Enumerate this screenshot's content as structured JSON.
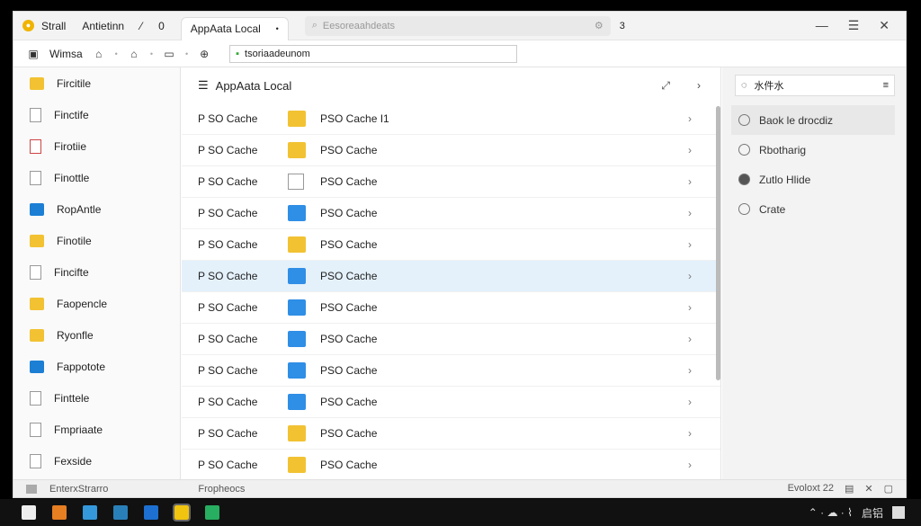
{
  "tabbar": {
    "app_label": "Strall",
    "tab2": "Antietinn",
    "tab2_count": "0",
    "active_tab": "AppAata Local",
    "search_placeholder": "Eesoreaahdeats",
    "extra": "3"
  },
  "toolbar": {
    "label": "Wimsa",
    "address": "tsoriaadeunom"
  },
  "sidebar": {
    "items": [
      {
        "label": "Fircitile",
        "icon": "folder-yellow"
      },
      {
        "label": "Finctife",
        "icon": "document"
      },
      {
        "label": "Firotiie",
        "icon": "document-red"
      },
      {
        "label": "Finottle",
        "icon": "document"
      },
      {
        "label": "RopAntle",
        "icon": "app-blue"
      },
      {
        "label": "Finotile",
        "icon": "folder-yellow"
      },
      {
        "label": "Fincifte",
        "icon": "document"
      },
      {
        "label": "Faopencle",
        "icon": "folder-yellow"
      },
      {
        "label": "Ryonfle",
        "icon": "folder-yellow"
      },
      {
        "label": "Fappotote",
        "icon": "app-blue"
      },
      {
        "label": "Finttele",
        "icon": "document"
      },
      {
        "label": "Fmpriaate",
        "icon": "document"
      },
      {
        "label": "Fexside",
        "icon": "document"
      }
    ]
  },
  "main": {
    "title": "AppAata Local",
    "rows": [
      {
        "c1": "P SO Cache",
        "c2": "PSO Cache  I1",
        "icon": "folder-yellow"
      },
      {
        "c1": "P SO Cache",
        "c2": "PSO Cache",
        "icon": "folder-yellow"
      },
      {
        "c1": "P SO Cache",
        "c2": "PSO Cache",
        "icon": "document"
      },
      {
        "c1": "P SO Cache",
        "c2": "PSO Cache",
        "icon": "folder-blue"
      },
      {
        "c1": "P SO Cache",
        "c2": "PSO Cache",
        "icon": "folder-yellow"
      },
      {
        "c1": "P SO Cache",
        "c2": "PSO Cache",
        "icon": "folder-blue"
      },
      {
        "c1": "P SO Cache",
        "c2": "PSO Cache",
        "icon": "folder-blue"
      },
      {
        "c1": "P SO Cache",
        "c2": "PSO Cache",
        "icon": "folder-blue"
      },
      {
        "c1": "P SO Cache",
        "c2": "PSO Cache",
        "icon": "folder-blue"
      },
      {
        "c1": "P SO Cache",
        "c2": "PSO Cache",
        "icon": "folder-blue"
      },
      {
        "c1": "P SO Cache",
        "c2": "PSO Cache",
        "icon": "folder-yellow"
      },
      {
        "c1": "P SO Cache",
        "c2": "PSO Cache",
        "icon": "folder-yellow"
      }
    ]
  },
  "right": {
    "search_value": "水件水",
    "options": [
      {
        "label": "Baok le drocdiz",
        "checked": false
      },
      {
        "label": "Rbotharig",
        "checked": false
      },
      {
        "label": "Zutlo Hlide",
        "checked": true
      },
      {
        "label": "Crate",
        "checked": false
      }
    ]
  },
  "statusbar": {
    "left": "EnterxStrarro",
    "middle": "Fropheocs",
    "right": "Evoloxt 22"
  },
  "taskbar": {
    "tray": "启铝"
  }
}
